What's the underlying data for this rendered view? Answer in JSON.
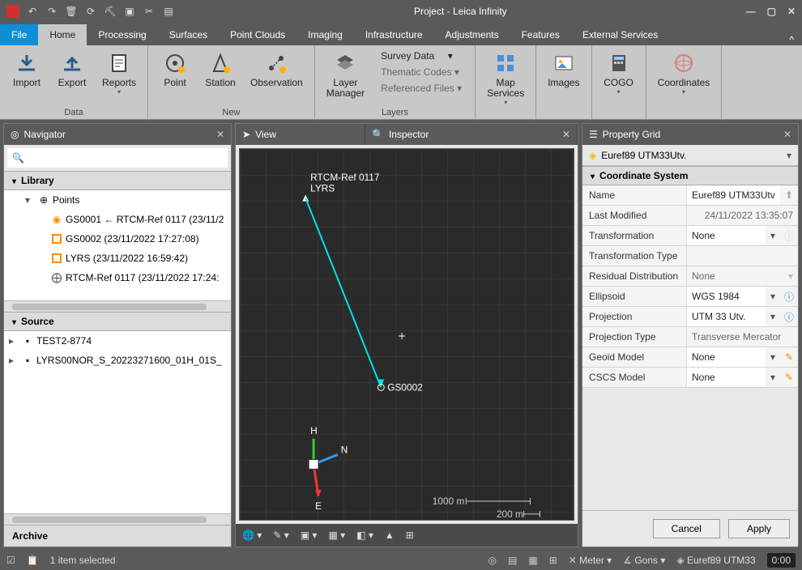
{
  "title": "Project - Leica Infinity",
  "menutabs": {
    "file": "File",
    "items": [
      "Home",
      "Processing",
      "Surfaces",
      "Point Clouds",
      "Imaging",
      "Infrastructure",
      "Adjustments",
      "Features",
      "External Services"
    ],
    "active": 0
  },
  "ribbon": {
    "data": {
      "caption": "Data",
      "import": "Import",
      "export": "Export",
      "reports": "Reports"
    },
    "new": {
      "caption": "New",
      "point": "Point",
      "station": "Station",
      "observation": "Observation"
    },
    "layers": {
      "caption": "Layers",
      "layer_manager": "Layer\nManager",
      "survey_data": "Survey Data",
      "thematic_codes": "Thematic Codes",
      "referenced_files": "Referenced Files"
    },
    "map_services": "Map\nServices",
    "images": "Images",
    "cogo": "COGO",
    "coordinates": "Coordinates"
  },
  "navigator": {
    "title": "Navigator",
    "search_placeholder": "",
    "library": "Library",
    "points_label": "Points",
    "points": [
      {
        "id": "GS0001",
        "label": "GS0001 ← RTCM-Ref 0117 (23/11/2",
        "icon": "target"
      },
      {
        "id": "GS0002",
        "label": "GS0002 (23/11/2022 17:27:08)",
        "icon": "sq"
      },
      {
        "id": "LYRS",
        "label": "LYRS (23/11/2022 16:59:42)",
        "icon": "sq"
      },
      {
        "id": "RTCM",
        "label": "RTCM-Ref 0117 (23/11/2022 17:24:",
        "icon": "rtcm"
      }
    ],
    "source": "Source",
    "sources": [
      "TEST2-8774",
      "LYRS00NOR_S_20223271600_01H_01S_"
    ],
    "archive": "Archive"
  },
  "viewpanel": {
    "view": "View",
    "inspector": "Inspector",
    "labels": {
      "rtcm": "RTCM-Ref 0117",
      "lyrs": "LYRS",
      "gs0002": "GS0002"
    },
    "axes": {
      "h": "H",
      "n": "N",
      "e": "E"
    },
    "scales": {
      "s1000": "1000 m",
      "s200": "200 m"
    }
  },
  "propgrid": {
    "title": "Property Grid",
    "context": "Euref89 UTM33Utv.",
    "section": "Coordinate System",
    "rows": {
      "name_k": "Name",
      "name_v": "Euref89 UTM33Utv",
      "last_mod_k": "Last Modified",
      "last_mod_v": "24/11/2022 13:35:07",
      "transf_k": "Transformation",
      "transf_v": "None",
      "transf_type_k": "Transformation Type",
      "transf_type_v": "",
      "resid_k": "Residual Distribution",
      "resid_v": "None",
      "ellipsoid_k": "Ellipsoid",
      "ellipsoid_v": "WGS 1984",
      "proj_k": "Projection",
      "proj_v": "UTM 33 Utv.",
      "proj_type_k": "Projection Type",
      "proj_type_v": "Transverse Mercator",
      "geoid_k": "Geoid Model",
      "geoid_v": "None",
      "cscs_k": "CSCS Model",
      "cscs_v": "None"
    },
    "cancel": "Cancel",
    "apply": "Apply"
  },
  "statusbar": {
    "selection": "1 item selected",
    "meter": "Meter",
    "gons": "Gons",
    "cs": "Euref89 UTM33",
    "time": "0:00"
  }
}
